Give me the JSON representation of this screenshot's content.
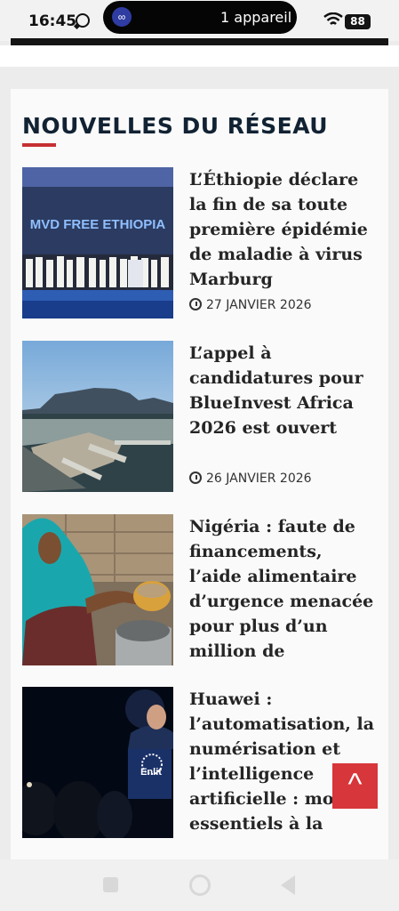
{
  "status": {
    "time": "16:45",
    "device_label": "1 appareil",
    "battery": "88"
  },
  "section": {
    "title": "NOUVELLES DU RÉSEAU"
  },
  "articles": [
    {
      "headline": "L’Éthiopie déclare la fin de sa toute première épidémie de maladie à virus Marburg",
      "date": "27 JANVIER 2026",
      "image_text": "MVD FREE ETHIOPIA"
    },
    {
      "headline": "L’appel à candidatures pour BlueInvest Africa 2026 est ouvert",
      "date": "26 JANVIER 2026"
    },
    {
      "headline": "Nigéria : faute de financements, l’aide alimentaire d’urgence menacée pour plus d’un million de"
    },
    {
      "headline": "Huawei : l’automatisation, la numérisation et l’intelligence artificielle : mots essentiels à la",
      "image_text": "Enlit"
    }
  ],
  "back_to_top": "^"
}
